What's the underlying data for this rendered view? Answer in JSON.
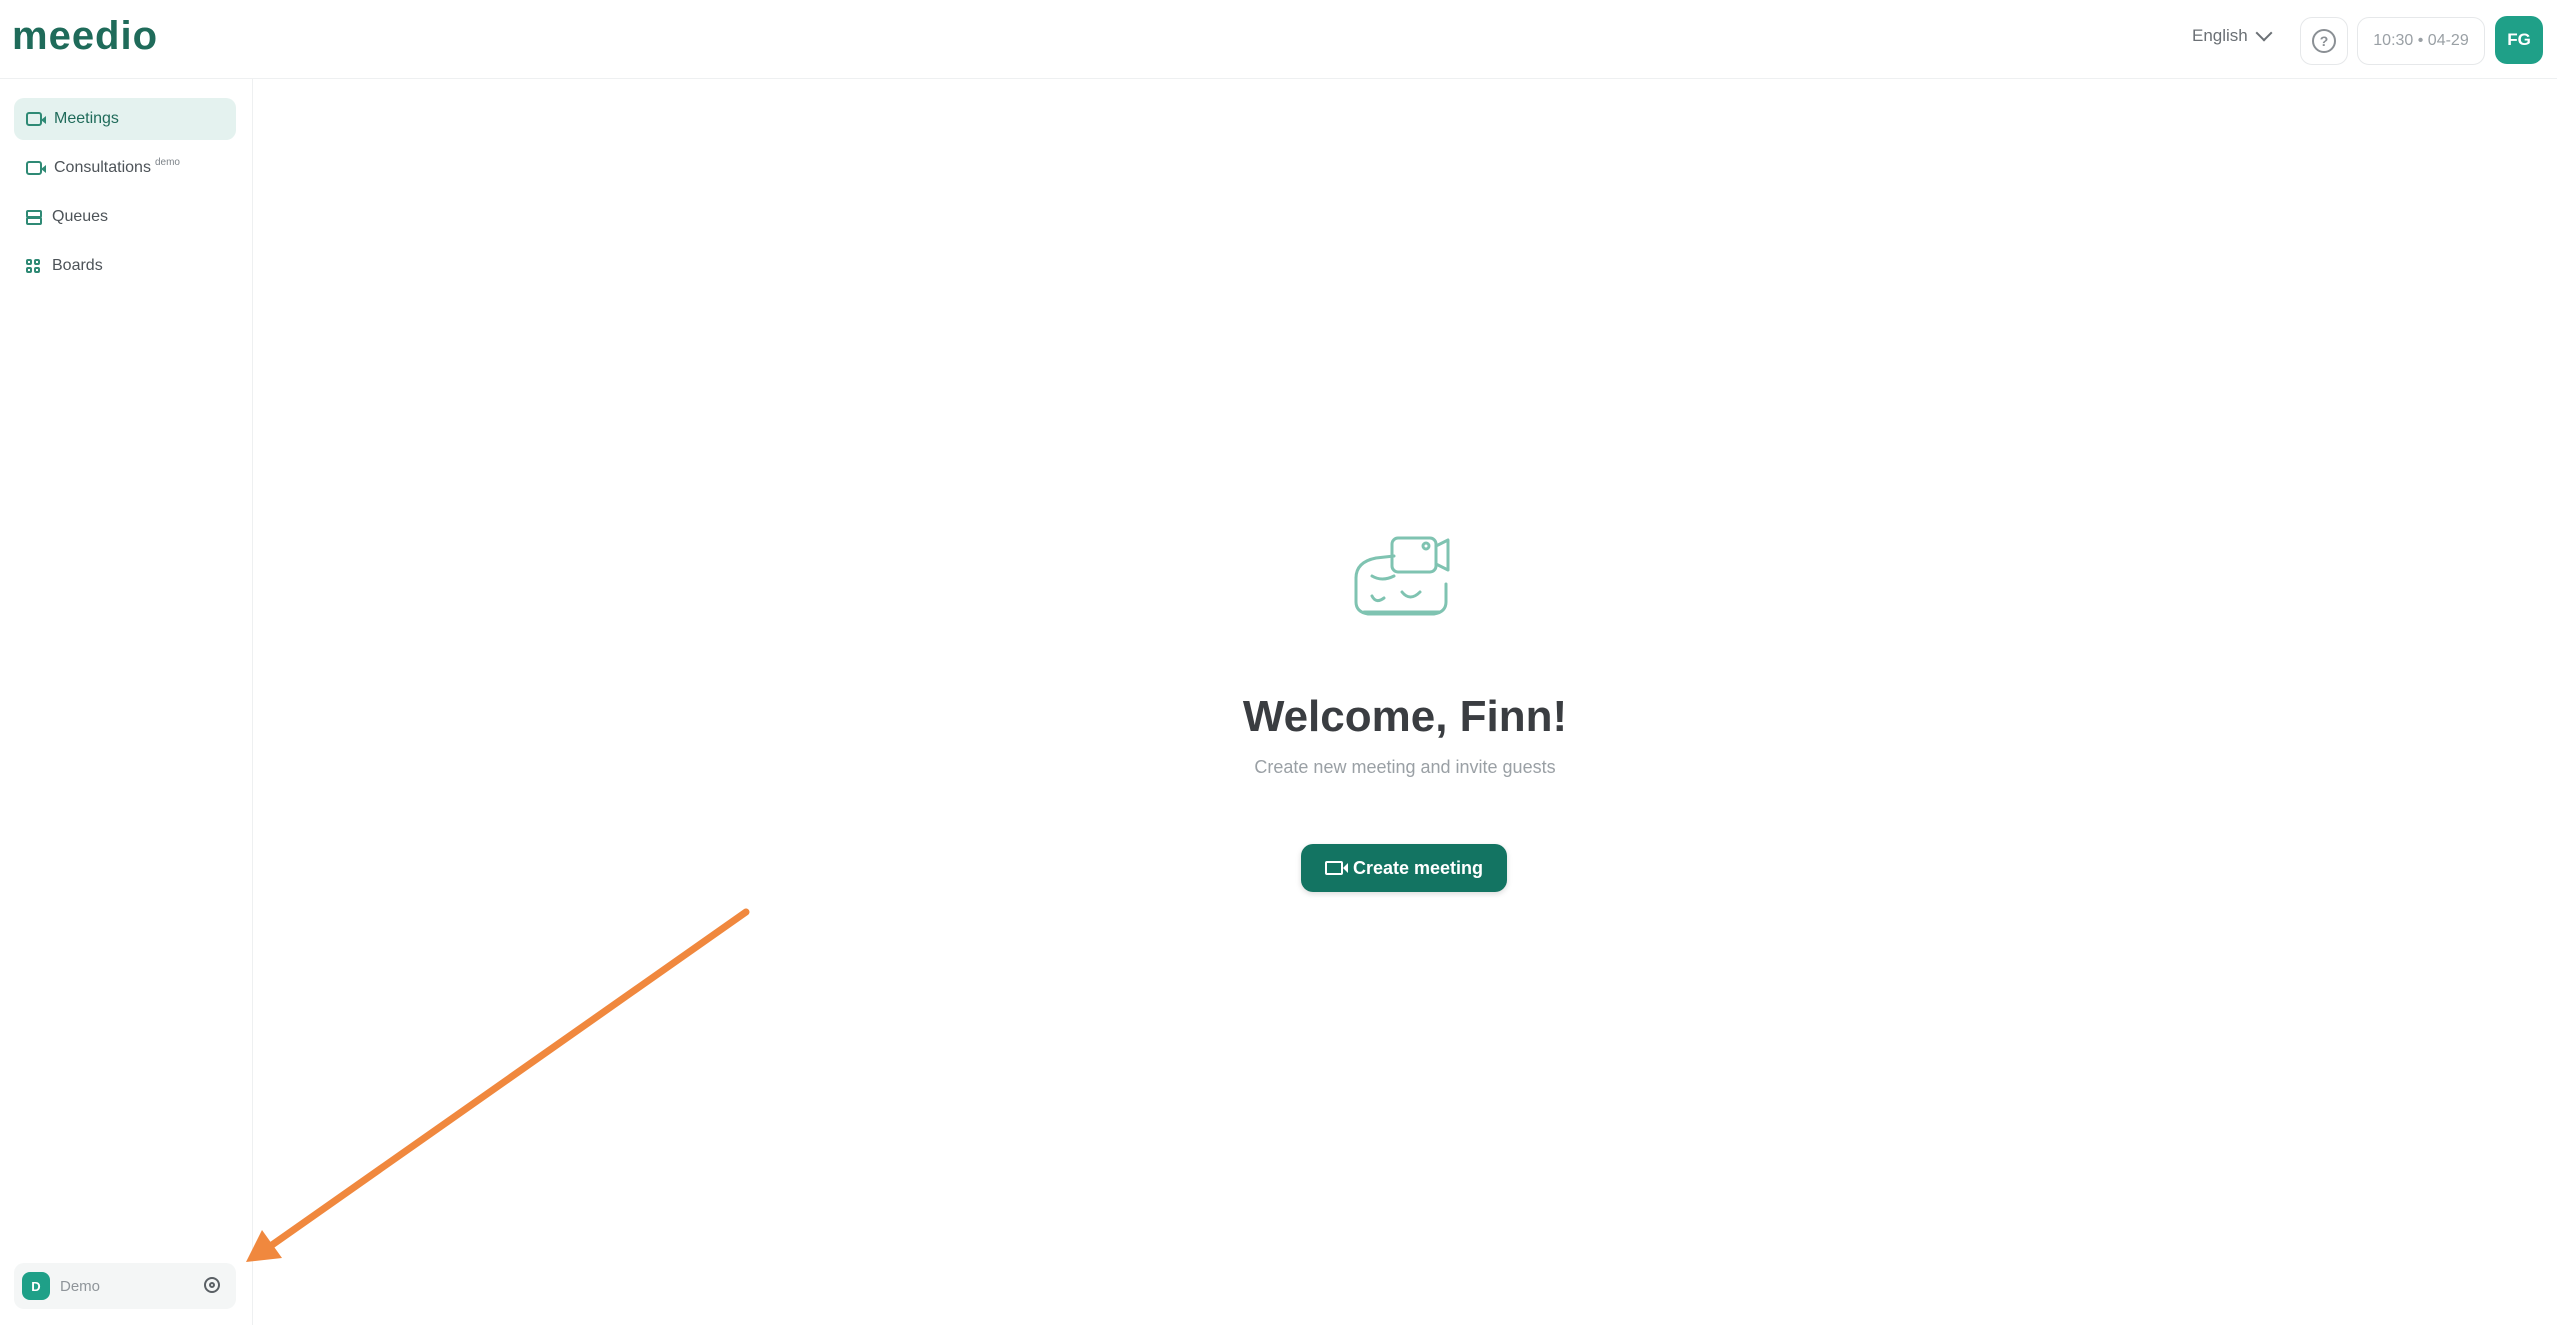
{
  "brand": {
    "logo_text": "meedio",
    "accent": "#1f6b5a",
    "button_bg": "#137462",
    "avatar_bg": "#1fa088"
  },
  "header": {
    "language": "English",
    "clock": "10:30 • 04-29",
    "user_initials": "FG"
  },
  "sidebar": {
    "items": [
      {
        "label": "Meetings",
        "icon": "video-icon",
        "active": true
      },
      {
        "label": "Consultations",
        "badge": "demo",
        "icon": "video-icon"
      },
      {
        "label": "Queues",
        "icon": "queue-icon"
      },
      {
        "label": "Boards",
        "icon": "grid-icon"
      }
    ],
    "workspace": {
      "initial": "D",
      "name": "Demo"
    }
  },
  "main": {
    "title": "Welcome, Finn!",
    "subtitle": "Create new meeting and invite guests",
    "create_button": "Create meeting"
  },
  "annotation": {
    "arrow_color": "#f0883e"
  }
}
